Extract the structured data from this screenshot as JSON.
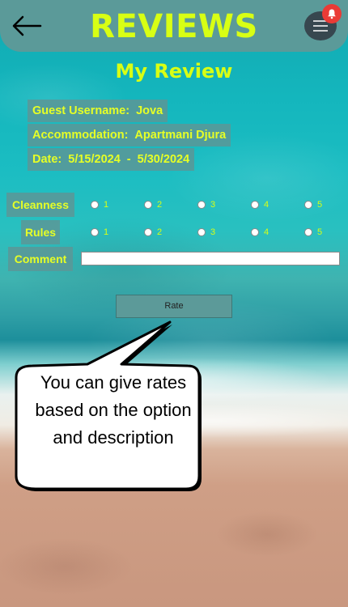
{
  "header": {
    "title": "REVIEWS",
    "back_icon": "arrow-left-icon",
    "menu_icon": "hamburger-menu-icon",
    "notification_icon": "bell-icon",
    "notification_color": "#ea3b36"
  },
  "page": {
    "subtitle": "My Review"
  },
  "info": {
    "guest_label": "Guest Username:",
    "guest_value": "Jova",
    "accommodation_label": "Accommodation:",
    "accommodation_value": "Apartmani Djura",
    "date_label": "Date:",
    "date_start": "5/15/2024",
    "date_separator": "-",
    "date_end": "5/30/2024"
  },
  "ratings": {
    "cleanness_label": "Cleanness",
    "rules_label": "Rules",
    "options": [
      "1",
      "2",
      "3",
      "4",
      "5"
    ]
  },
  "comment": {
    "label": "Comment",
    "value": ""
  },
  "rate_button": {
    "label": "Rate"
  },
  "tooltip": {
    "text": "You can give rates based on the option and description"
  },
  "colors": {
    "accent": "#d8ff14",
    "panel": "#5b9a99",
    "menu_button": "#37474f"
  }
}
